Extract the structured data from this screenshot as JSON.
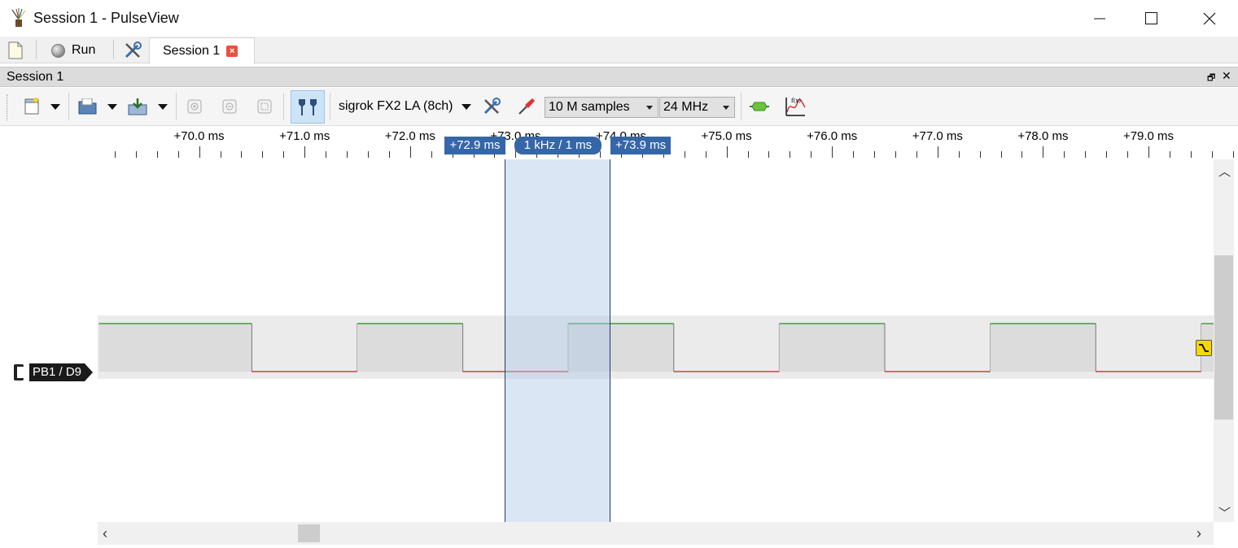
{
  "window": {
    "title": "Session 1 - PulseView"
  },
  "tabbar": {
    "run_label": "Run",
    "session_tab_label": "Session 1"
  },
  "dock": {
    "title": "Session 1"
  },
  "toolbar": {
    "device": "sigrok FX2 LA (8ch)",
    "samples": "10 M samples",
    "samplerate": "24 MHz"
  },
  "ruler": {
    "ticks": [
      "+70.0 ms",
      "+71.0 ms",
      "+72.0 ms",
      "+73.0 ms",
      "+74.0 ms",
      "+75.0 ms",
      "+76.0 ms",
      "+77.0 ms",
      "+78.0 ms",
      "+79.0 ms"
    ]
  },
  "cursors": {
    "left_label": "+72.9 ms",
    "right_label": "+73.9 ms",
    "delta_label": "1 kHz / 1 ms",
    "left_ms": 72.9,
    "right_ms": 73.9
  },
  "channel": {
    "name": "PB1 / D9"
  },
  "signal": {
    "high_color": "#1d8f1d",
    "low_color": "#c02020",
    "edges_ms": [
      70.5,
      71.5,
      72.5,
      73.5,
      74.5,
      75.5,
      76.5,
      77.5,
      78.5,
      79.5
    ],
    "start_ms": 69.05,
    "end_ms": 79.62,
    "start_level": "high"
  },
  "colors": {
    "cursor": "#3566a8",
    "trigger": "#f5d800"
  }
}
